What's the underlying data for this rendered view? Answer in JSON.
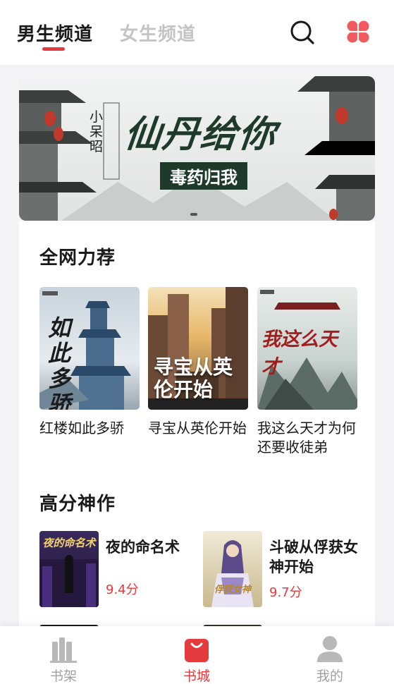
{
  "header": {
    "tabs": [
      {
        "label": "男生频道",
        "active": true
      },
      {
        "label": "女生频道",
        "active": false
      }
    ],
    "accent": "#e33b3e"
  },
  "banner": {
    "author": "小呆昭",
    "title": "仙丹给你",
    "subtitle": "毒药归我"
  },
  "recommend": {
    "title": "全网力荐",
    "books": [
      {
        "title": "红楼如此多骄",
        "cover_text": "如此多骄"
      },
      {
        "title": "寻宝从英伦开始",
        "cover_text": "寻宝从英伦开始"
      },
      {
        "title": "我这么天才为何还要收徒弟",
        "cover_text": "我这么天才"
      }
    ]
  },
  "top_rated": {
    "title": "高分神作",
    "books": [
      {
        "title": "夜的命名术",
        "score": "9.4分",
        "cover_text": "夜的命名术"
      },
      {
        "title": "斗破从俘获女神开始",
        "score": "9.7分",
        "cover_text": "俘获女神"
      }
    ]
  },
  "bottom_nav": [
    {
      "label": "书架",
      "icon": "bookshelf-icon",
      "active": false
    },
    {
      "label": "书城",
      "icon": "bookstore-bag-icon",
      "active": true
    },
    {
      "label": "我的",
      "icon": "user-icon",
      "active": false
    }
  ]
}
